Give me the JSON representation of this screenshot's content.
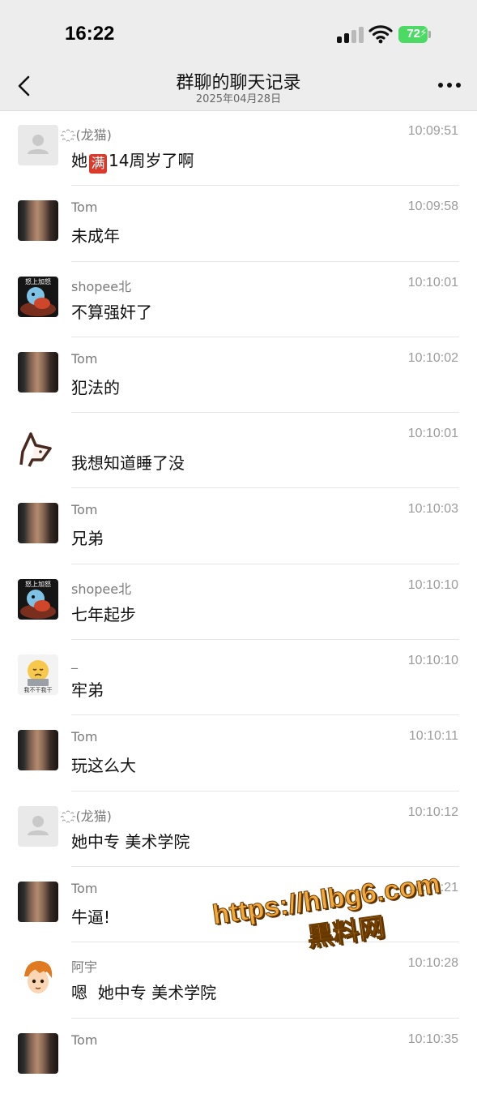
{
  "status": {
    "time": "16:22",
    "battery": "72",
    "icons": [
      "cellular-signal-icon",
      "wifi-icon",
      "battery-charging-icon"
    ]
  },
  "nav": {
    "title": "群聊的聊天记录",
    "subtitle": "2025年04月28日",
    "back_icon": "chevron-left-icon",
    "more_icon": "more-dots-icon"
  },
  "messages": [
    {
      "name": "(龙猫)",
      "name_prefix_icon": "spinner-emoji-icon",
      "time": "10:09:51",
      "text_pre": "她",
      "emoji": "满",
      "text_post": "14周岁了啊",
      "avatar": "default-avatar"
    },
    {
      "name": "Tom",
      "time": "10:09:58",
      "text": "未成年",
      "avatar": "man-portrait"
    },
    {
      "name": "shopee北",
      "time": "10:10:01",
      "text": "不算强奸了",
      "avatar": "squirtle-sticker",
      "avatar_caption": "怒上加怒"
    },
    {
      "name": "Tom",
      "time": "10:10:02",
      "text": "犯法的",
      "avatar": "man-portrait"
    },
    {
      "name": "",
      "time": "10:10:01",
      "text": "我想知道睡了没",
      "avatar": "sketch-drawing"
    },
    {
      "name": "Tom",
      "time": "10:10:03",
      "text": "兄弟",
      "avatar": "man-portrait"
    },
    {
      "name": "shopee北",
      "time": "10:10:10",
      "text": "七年起步",
      "avatar": "squirtle-sticker",
      "avatar_caption": "怒上加怒"
    },
    {
      "name": "_",
      "time": "10:10:10",
      "text": "牢弟",
      "avatar": "sad-emoji-laptop",
      "avatar_caption": "我不干我干"
    },
    {
      "name": "Tom",
      "time": "10:10:11",
      "text": "玩这么大",
      "avatar": "man-portrait"
    },
    {
      "name": "(龙猫)",
      "name_prefix_icon": "spinner-emoji-icon",
      "time": "10:10:12",
      "text": "她中专 美术学院",
      "avatar": "default-avatar"
    },
    {
      "name": "Tom",
      "time": "10:10:21",
      "text": "牛逼!",
      "avatar": "man-portrait"
    },
    {
      "name": "阿宇",
      "time": "10:10:28",
      "text": "嗯  她中专 美术学院",
      "avatar": "anime-boy"
    },
    {
      "name": "Tom",
      "time": "10:10:35",
      "text": "",
      "avatar": "man-portrait"
    }
  ],
  "watermark": {
    "url": "https://hlbg6.com",
    "label": "黑料网"
  },
  "colors": {
    "header_bg": "#ededed",
    "battery_green": "#4cd964",
    "watermark_orange": "#f2a83b"
  }
}
